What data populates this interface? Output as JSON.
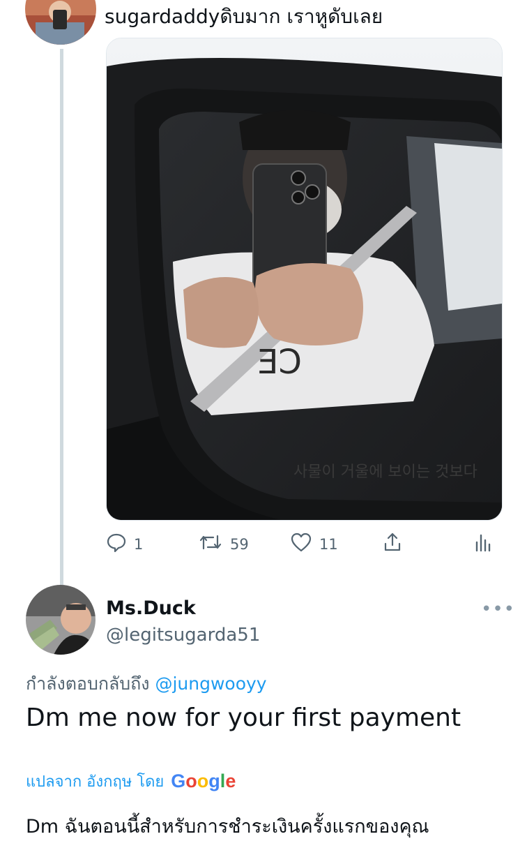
{
  "tweet": {
    "text": "sugardaddyดิบมาก เราหูดับเลย",
    "media_overlay_text": "사물이 거울에 보이는 것보다",
    "shirt_text": "CE",
    "actions": {
      "reply_count": "1",
      "retweet_count": "59",
      "like_count": "11"
    }
  },
  "reply": {
    "display_name": "Ms.Duck",
    "handle": "@legitsugarda51",
    "more_label": "•••",
    "replying_to_label": "กำลังตอบกลับถึง",
    "replying_to_handle": "@jungwooyy",
    "text": "Dm me now for your first payment",
    "translate_label": "แปลจาก อังกฤษ โดย",
    "translation_provider": "Google",
    "translated_text": "Dm ฉันตอนนี้สำหรับการชำระเงินครั้งแรกของคุณ"
  },
  "colors": {
    "link": "#1d9bf0",
    "secondary_text": "#536471",
    "thread_line": "#cfd9de"
  },
  "icons": [
    "reply-icon",
    "retweet-icon",
    "like-icon",
    "share-icon",
    "analytics-icon"
  ]
}
